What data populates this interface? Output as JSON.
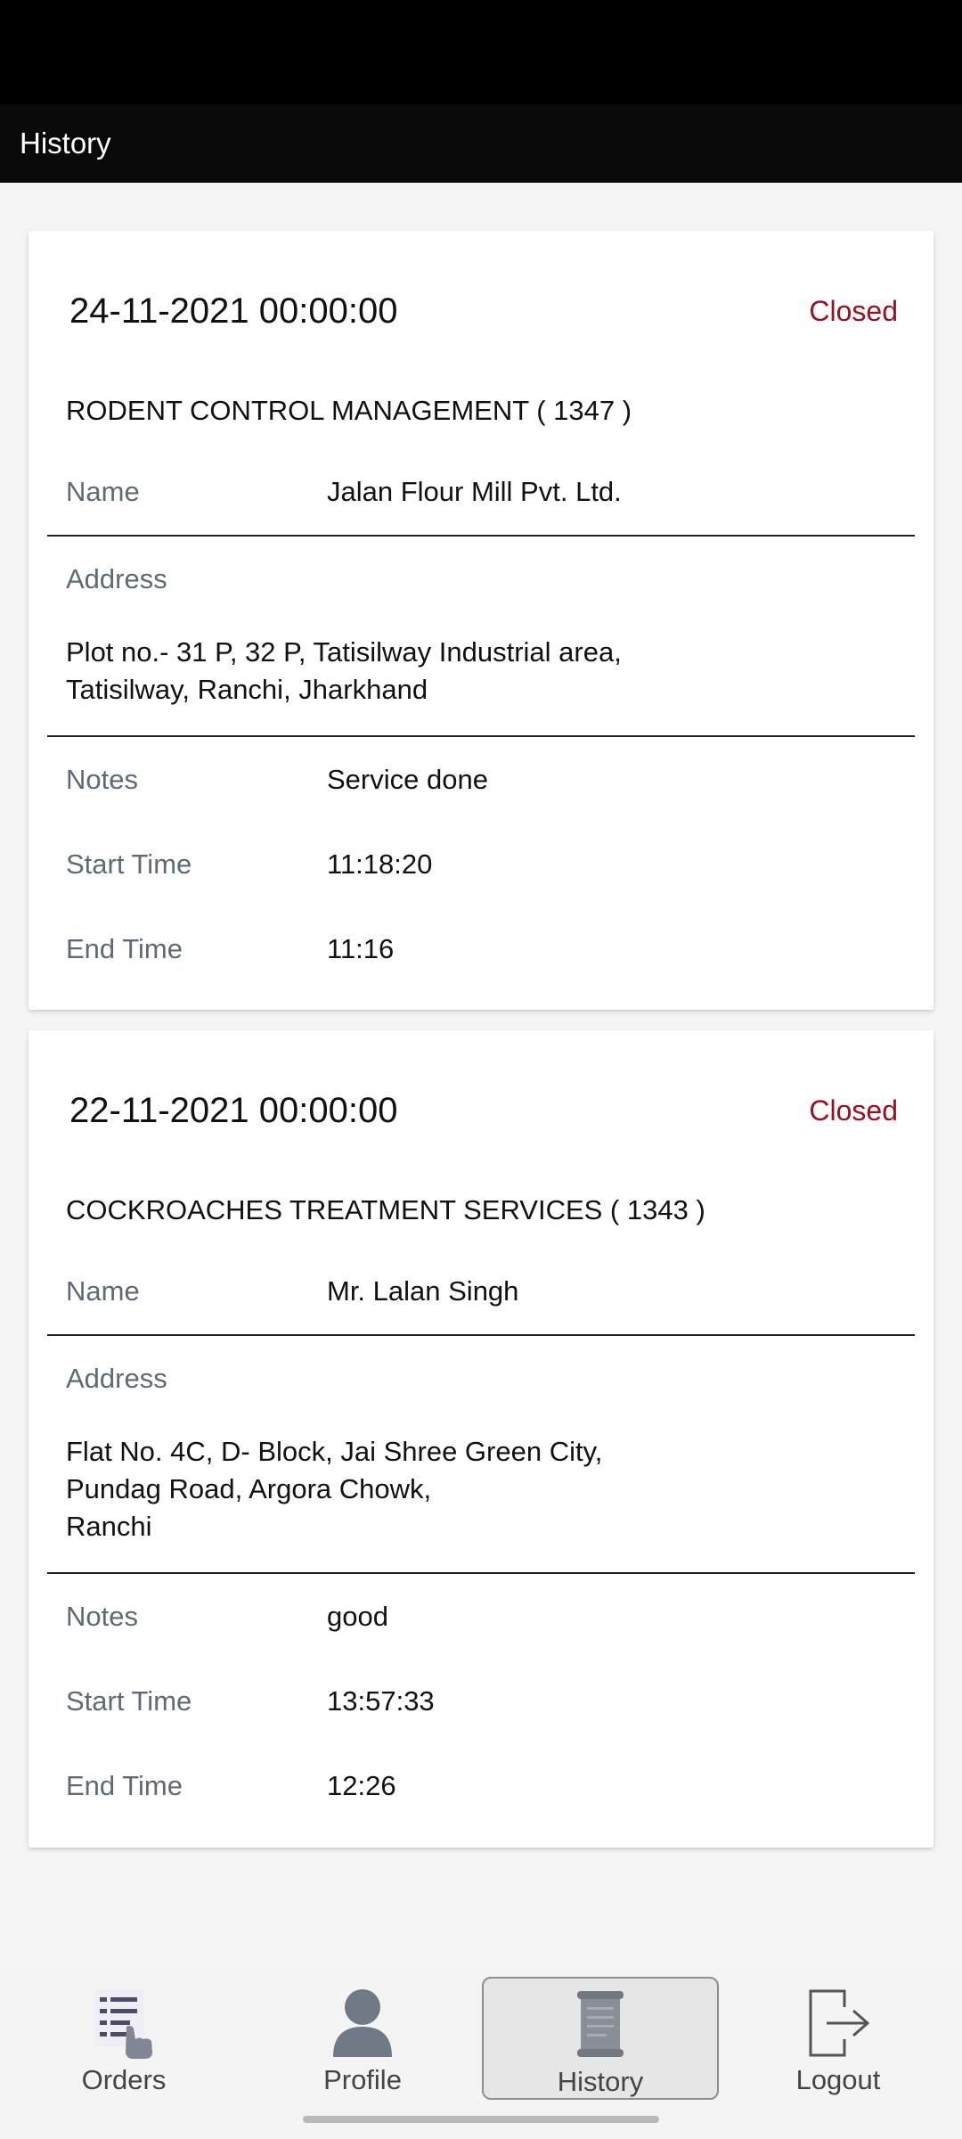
{
  "app_bar": {
    "title": "History"
  },
  "orders": [
    {
      "date": "24-11-2021 00:00:00",
      "status": "Closed",
      "service": "RODENT CONTROL MANAGEMENT ( 1347 )",
      "name_label": "Name",
      "name": "Jalan Flour Mill Pvt. Ltd.",
      "address_label": "Address",
      "address_lines": [
        "Plot no.- 31 P, 32 P, Tatisilway Industrial area,",
        "Tatisilway, Ranchi, Jharkhand"
      ],
      "notes_label": "Notes",
      "notes": "Service done",
      "start_label": "Start Time",
      "start_time": "11:18:20",
      "end_label": "End Time",
      "end_time": "11:16"
    },
    {
      "date": "22-11-2021 00:00:00",
      "status": "Closed",
      "service": "COCKROACHES TREATMENT SERVICES ( 1343 )",
      "name_label": "Name",
      "name": "Mr. Lalan Singh",
      "address_label": "Address",
      "address_lines": [
        "Flat No. 4C, D- Block, Jai Shree Green City,",
        "Pundag Road, Argora Chowk,",
        "Ranchi"
      ],
      "notes_label": "Notes",
      "notes": "good",
      "start_label": "Start Time",
      "start_time": "13:57:33",
      "end_label": "End Time",
      "end_time": "12:26"
    }
  ],
  "bottom_nav": {
    "items": [
      {
        "label": "Orders",
        "icon": "orders-list-icon"
      },
      {
        "label": "Profile",
        "icon": "profile-person-icon"
      },
      {
        "label": "History",
        "icon": "history-scroll-icon",
        "active": true
      },
      {
        "label": "Logout",
        "icon": "logout-icon"
      }
    ]
  }
}
